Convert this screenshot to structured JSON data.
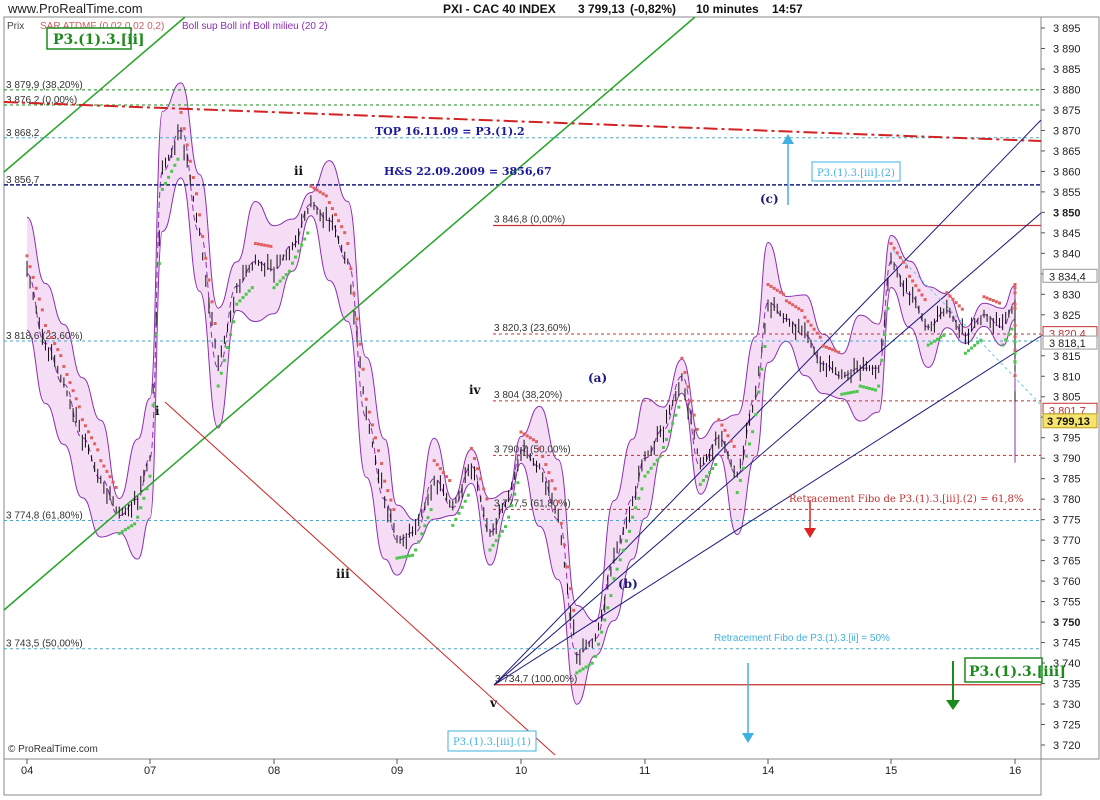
{
  "header": {
    "site": "www.ProRealTime.com",
    "title": "PXI - CAC 40 INDEX",
    "price": "3 799,13",
    "change": "(-0,82%)",
    "interval": "10 minutes",
    "time": "14:57"
  },
  "legend": {
    "panel_label": "Prix",
    "sar_label": "SAR ATDMF (0,02 0,02 0,2)",
    "boll_label": "Boll sup Boll inf Boll milieu (20 2)"
  },
  "footer_logo": "© ProRealTime.com",
  "colors": {
    "bollinger_fill": "#f3d7f3",
    "bollinger_line": "#8a2fb2",
    "sar_above": "#e06060",
    "sar_below": "#4cc64c",
    "grid": "#e6e6e6",
    "navy_line": "#1a1a7a",
    "green_channel": "#27a327",
    "red_trend": "#d32222"
  },
  "chart_data": {
    "type": "line",
    "title": "PXI - CAC 40 INDEX",
    "interval": "10 minutes",
    "ylim": [
      3716,
      3897
    ],
    "yticks": [
      3720,
      3725,
      3730,
      3735,
      3740,
      3745,
      3750,
      3755,
      3760,
      3765,
      3770,
      3775,
      3780,
      3785,
      3790,
      3795,
      3800,
      3805,
      3810,
      3815,
      3820,
      3825,
      3830,
      3835,
      3840,
      3845,
      3850,
      3855,
      3860,
      3865,
      3870,
      3875,
      3880,
      3885,
      3890,
      3895
    ],
    "ytick_labels": [
      "3 720",
      "3 725",
      "3 730",
      "3 735",
      "3 740",
      "3 745",
      "3 750",
      "3 755",
      "3 760",
      "3 765",
      "3 770",
      "3 775",
      "3 780",
      "3 785",
      "3 790",
      "3 795",
      "3 800",
      "3 805",
      "3 810",
      "3 815",
      "3 820",
      "3 825",
      "3 830",
      "3 835",
      "3 840",
      "3 845",
      "3 850",
      "3 855",
      "3 860",
      "3 865",
      "3 870",
      "3 875",
      "3 880",
      "3 885",
      "3 890",
      "3 895"
    ],
    "bold_yticks": [
      "3 750",
      "3 850"
    ],
    "x_days": [
      "04",
      "07",
      "08",
      "09",
      "10",
      "11",
      "14",
      "15",
      "16"
    ],
    "series": [
      {
        "name": "",
        "x": [
          0,
          0.15,
          0.3,
          0.45,
          0.6,
          0.75,
          0.9,
          1.0,
          1.1,
          1.25,
          1.4,
          1.55,
          1.7,
          1.85,
          2.0,
          2.15,
          2.3,
          2.45,
          2.6,
          2.75,
          2.9,
          3.0,
          3.15,
          3.3,
          3.45,
          3.6,
          3.75,
          3.9,
          4.0,
          4.15,
          4.3,
          4.45,
          4.6,
          4.75,
          4.9,
          5.0,
          5.15,
          5.3,
          5.45,
          5.6,
          5.75,
          5.9,
          6.0,
          6.15,
          6.3,
          6.45,
          6.6,
          6.75,
          6.9,
          7.0,
          7.15,
          7.3,
          7.45,
          7.6,
          7.75,
          7.9,
          8.0,
          8.15,
          8.3,
          8.45,
          8.6,
          8.75,
          8.85,
          8.92
        ],
        "values": [
          3835,
          3818,
          3808,
          3795,
          3785,
          3776,
          3780,
          3790,
          3860,
          3870,
          3845,
          3812,
          3832,
          3838,
          3836,
          3842,
          3852,
          3848,
          3838,
          3800,
          3780,
          3770,
          3772,
          3785,
          3778,
          3788,
          3772,
          3780,
          3792,
          3788,
          3775,
          3742,
          3746,
          3765,
          3780,
          3790,
          3797,
          3810,
          3788,
          3795,
          3786,
          3805,
          3828,
          3824,
          3820,
          3813,
          3810,
          3812,
          3812,
          3838,
          3830,
          3822,
          3826,
          3820,
          3825,
          3822,
          3828,
          3826,
          3820,
          3826,
          3818,
          3818,
          3812,
          3799.13
        ]
      }
    ],
    "last_price": "3 799,13",
    "price_boxes": [
      "3 834,4",
      "3 820,4",
      "3 818,1",
      "3 801,7"
    ],
    "right_boxes": [
      "3 834,4",
      "3 820,4",
      "3 818,1",
      "3 801,7",
      "3 799,13"
    ],
    "fibo_left": [
      {
        "value": 3879.9,
        "label": "3 879,9 (38,20%)"
      },
      {
        "value": 3876.2,
        "label": "3 876,2 (0,00%)"
      },
      {
        "value": 3868.2,
        "label": "3 868,2"
      },
      {
        "value": 3856.7,
        "label": "3 856,7"
      },
      {
        "value": 3818.6,
        "label": "3 818,6 (23,60%)"
      },
      {
        "value": 3774.8,
        "label": "3 774,8 (61,80%)"
      },
      {
        "value": 3743.5,
        "label": "3 743,5 (50,00%)"
      }
    ],
    "fibo_mid": [
      {
        "value": 3846.8,
        "label": "3 846,8 (0,00%)"
      },
      {
        "value": 3820.3,
        "label": "3 820,3 (23,60%)"
      },
      {
        "value": 3804,
        "label": "3 804 (38,20%)"
      },
      {
        "value": 3790.7,
        "label": "3 790,7 (50,00%)"
      },
      {
        "value": 3777.5,
        "label": "3 777,5 (61,80%)"
      },
      {
        "value": 3734.7,
        "label": "3 734,7 (100,00%)"
      }
    ],
    "annotations": {
      "top_line": "TOP 16.11.09 = P3.(1).2",
      "hs_line": "H&S 22.09.2009 = 3856,67",
      "ret_618": "Retracement Fibo de P3.(1).3.[iii].(2) = 61,8%",
      "ret_50": "Retracement Fibo de P3.(1).3.[ii] = 50%",
      "box_ii": "P3.(1).3.[ii]",
      "box_iii": "P3.(1).3.[iii]",
      "box_iii_2": "P3.(1).3.[iii].(2)",
      "box_iii_1": "P3.(1).3.[iii].(1)",
      "waves": [
        "i",
        "ii",
        "iii",
        "iv",
        "v",
        "(a)",
        "(b)",
        "(c)"
      ]
    }
  }
}
